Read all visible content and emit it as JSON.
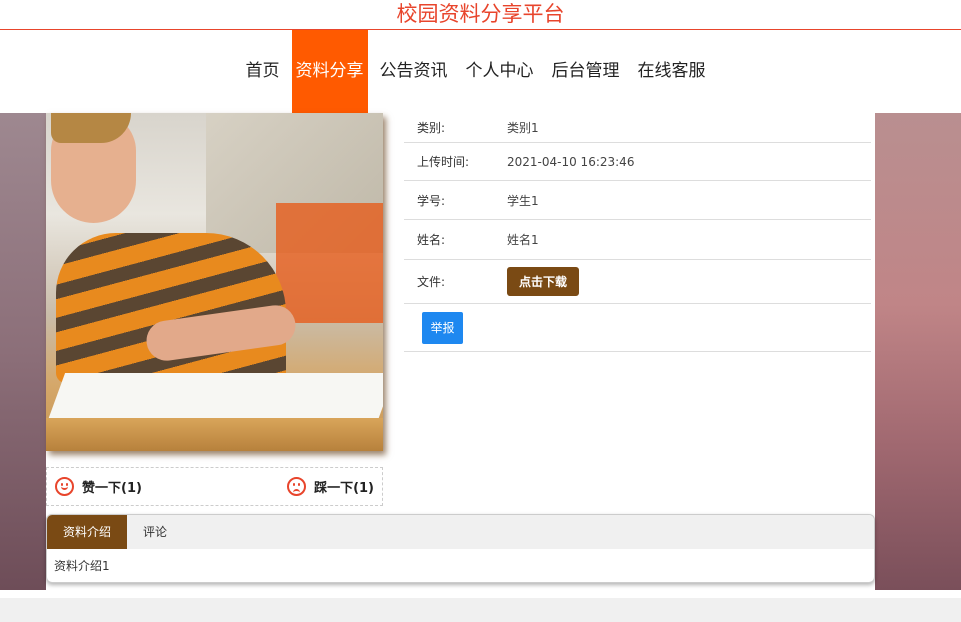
{
  "site_title": "校园资料分享平台",
  "nav": [
    "首页",
    "资料分享",
    "公告资讯",
    "个人中心",
    "后台管理",
    "在线客服"
  ],
  "vote": {
    "like": "赞一下(1)",
    "dislike": "踩一下(1)"
  },
  "info": [
    {
      "label": "类别:",
      "value": "类别1"
    },
    {
      "label": "上传时间:",
      "value": "2021-04-10 16:23:46"
    },
    {
      "label": "学号:",
      "value": "学生1"
    },
    {
      "label": "姓名:",
      "value": "姓名1"
    },
    {
      "label": "文件:",
      "value": "点击下载"
    }
  ],
  "report_label": "举报",
  "tabs": [
    "资料介绍",
    "评论"
  ],
  "tab_content": "资料介绍1",
  "colors": {
    "brand": "#e8452c",
    "nav_active": "#ff5a00",
    "accent": "#7a4a14",
    "report": "#1e88f0"
  }
}
